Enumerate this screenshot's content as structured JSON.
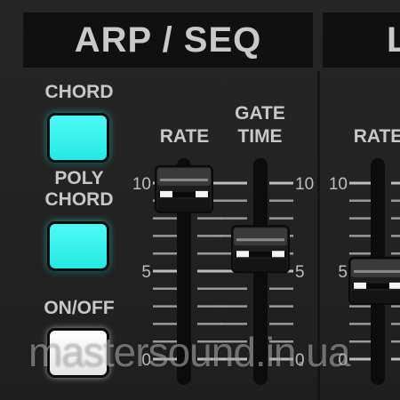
{
  "sections": {
    "arp_seq_title": "ARP / SEQ",
    "next_title": "L"
  },
  "buttons": {
    "chord": {
      "label": "CHORD",
      "color": "#3af2ee",
      "state": "on"
    },
    "poly_chord": {
      "label_line1": "POLY",
      "label_line2": "CHORD",
      "color": "#3af2ee",
      "state": "on"
    },
    "on_off": {
      "label": "ON/OFF",
      "color": "#ffffff",
      "state": "on"
    }
  },
  "sliders": {
    "rate": {
      "label": "RATE",
      "value": 9.6,
      "min": 0,
      "max": 10
    },
    "gate_time": {
      "label_line1": "GATE",
      "label_line2": "TIME",
      "value": 6.2,
      "min": 0,
      "max": 10
    },
    "rate_2": {
      "label": "RATE",
      "value": 4.4,
      "min": 0,
      "max": 10
    }
  },
  "scale_labels": {
    "top": "10",
    "mid": "5",
    "bottom": "0"
  },
  "watermark": "mastersound.in.ua"
}
